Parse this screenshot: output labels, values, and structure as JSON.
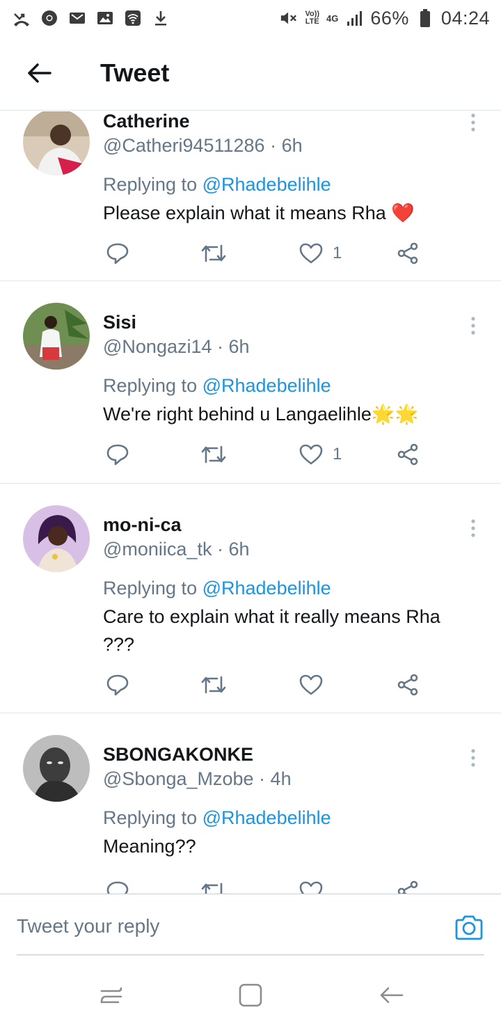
{
  "status_bar": {
    "battery": "66%",
    "time": "04:24",
    "network": "4G",
    "volte": [
      "Vo))",
      "LTE"
    ]
  },
  "header": {
    "title": "Tweet"
  },
  "tweets": [
    {
      "name": "Catherine",
      "handle": "@Catheri94511286 · 6h",
      "replying_prefix": "Replying to ",
      "replying_to": "@Rhadebelihle",
      "text": "Please explain what it means Rha ❤️",
      "likes": "1"
    },
    {
      "name": "Sisi",
      "handle": "@Nongazi14 · 6h",
      "replying_prefix": "Replying to ",
      "replying_to": "@Rhadebelihle",
      "text": "We're right behind u Langaelihle🌟🌟",
      "likes": "1"
    },
    {
      "name": "mo-ni-ca",
      "handle": "@moniica_tk · 6h",
      "replying_prefix": "Replying to ",
      "replying_to": "@Rhadebelihle",
      "text": "Care to explain what it really means Rha ???",
      "likes": ""
    },
    {
      "name": "SBONGAKONKE",
      "handle": "@Sbonga_Mzobe · 4h",
      "replying_prefix": "Replying to ",
      "replying_to": "@Rhadebelihle",
      "text": "Meaning??",
      "likes": ""
    }
  ],
  "composer": {
    "placeholder": "Tweet your reply"
  },
  "colors": {
    "link": "#1b95e0",
    "secondary_text": "#657786",
    "primary_text": "#14171a",
    "divider": "#e1e8ed"
  }
}
